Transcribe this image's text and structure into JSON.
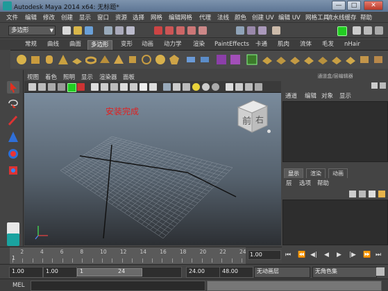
{
  "window": {
    "title": "Autodesk Maya 2014 x64: 无标题*",
    "controls": {
      "minimize": "—",
      "maximize": "□",
      "close": "✕"
    }
  },
  "menubar": [
    "文件",
    "编辑",
    "修改",
    "创建",
    "显示",
    "窗口",
    "资源",
    "选择",
    "网格",
    "编辑网格",
    "代理",
    "法线",
    "颜色",
    "创建 UV",
    "编辑 UV",
    "网格工具",
    "流水线缓存",
    "帮助"
  ],
  "statusline": {
    "mode": "多边形"
  },
  "shelf_tabs": [
    "常规",
    "曲线",
    "曲面",
    "多边形",
    "变形",
    "动画",
    "动力学",
    "渲染",
    "PaintEffects",
    "卡通",
    "肌肉",
    "流体",
    "毛发",
    "nHair"
  ],
  "shelf_active_tab": "多边形",
  "viewport": {
    "menus": [
      "视图",
      "着色",
      "照明",
      "显示",
      "渲染器",
      "面板"
    ],
    "message": "安装完成",
    "viewcube": {
      "front": "前",
      "right": "右"
    }
  },
  "channel_box": {
    "header": "通道盒/层编辑器",
    "menus": [
      "通道",
      "编辑",
      "对象",
      "显示"
    ]
  },
  "layer_editor": {
    "tabs": [
      "显示",
      "渲染",
      "动画"
    ],
    "active_tab": "显示",
    "menus": [
      "层",
      "选项",
      "帮助"
    ]
  },
  "time_slider": {
    "ticks": [
      "2",
      "4",
      "6",
      "8",
      "10",
      "12",
      "14",
      "16",
      "18",
      "20",
      "22",
      "24"
    ],
    "current_frame": "1.00",
    "start_marker": "1"
  },
  "range": {
    "start_time": "1.00",
    "playback_start": "1.00",
    "range_start_label": "1",
    "range_end_label": "24",
    "playback_end": "24.00",
    "end_time": "48.00",
    "anim_layer": "无动画层",
    "character_set": "无角色集"
  },
  "command_line": {
    "label": "MEL"
  }
}
